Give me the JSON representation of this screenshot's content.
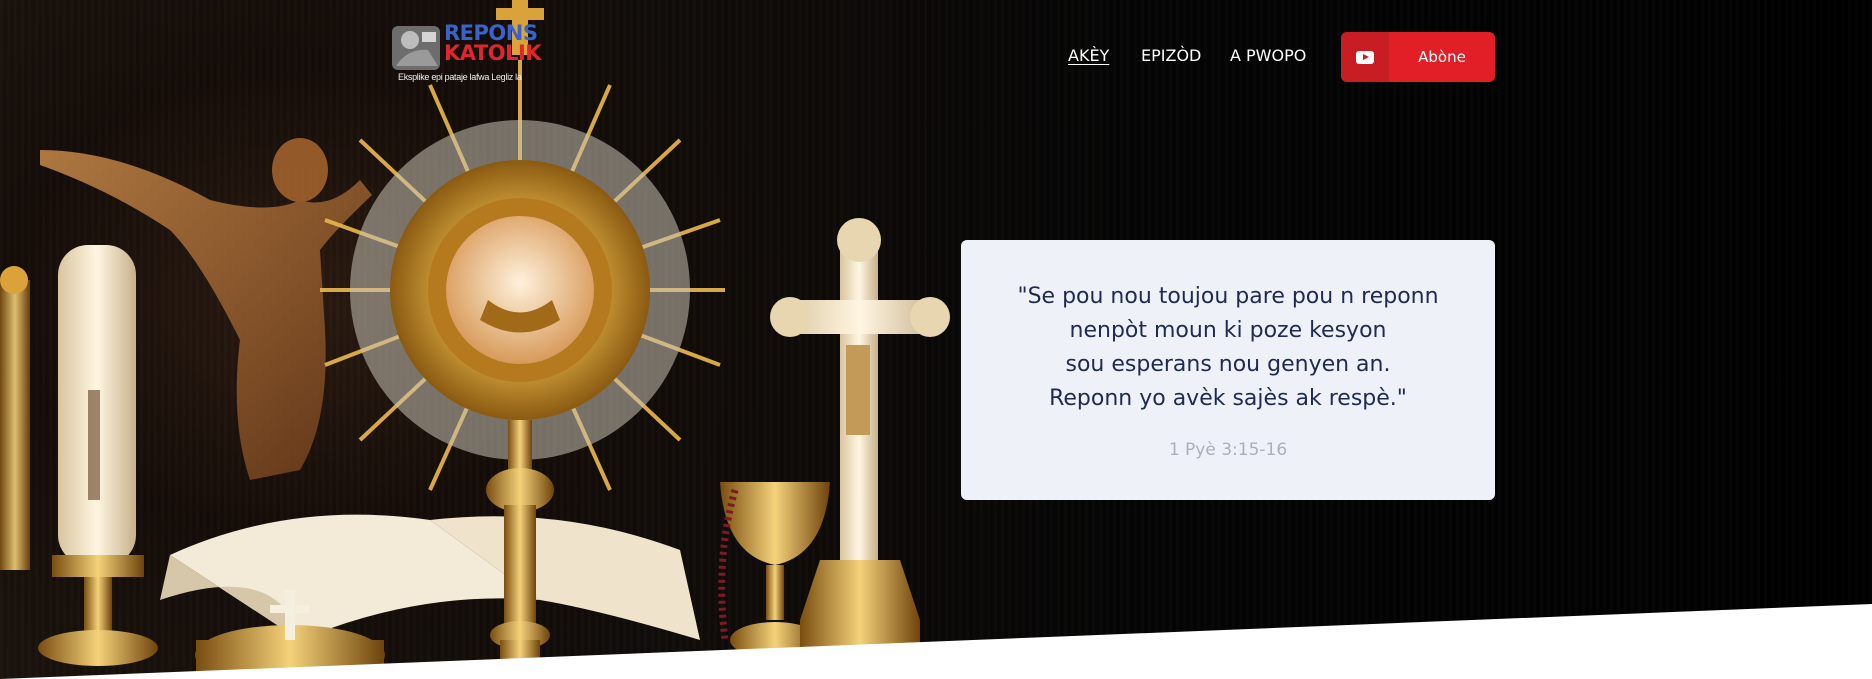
{
  "header": {
    "logo": {
      "line1": "REPONS",
      "line2": "KATOLIK",
      "tagline": "Eksplike epi pataje lafwa Legliz la",
      "line1_color": "#3a63c9",
      "line2_color": "#e0262a"
    },
    "nav": [
      {
        "label": "AKÈY",
        "active": true
      },
      {
        "label": "EPIZÒD",
        "active": false
      },
      {
        "label": "A PWOPO",
        "active": false
      }
    ],
    "subscribe": {
      "label": "Abòne",
      "icon": "youtube-icon",
      "color": "#e21f26"
    }
  },
  "quote": {
    "lines": [
      "\"Se pou nou toujou pare pou n reponn",
      "nenpòt moun ki poze kesyon",
      "sou esperans nou genyen an.",
      "Reponn yo avèk sajès ak respè.\""
    ],
    "reference": "1 Pyè 3:15-16"
  },
  "hero_image": {
    "subject": "monstrance-crucifix-chalice-candle-bible"
  },
  "colors": {
    "accent": "#e21f26",
    "card_bg": "#eef2f8",
    "quote_text": "#1e2a4f",
    "reference_text": "#a9afbc"
  }
}
